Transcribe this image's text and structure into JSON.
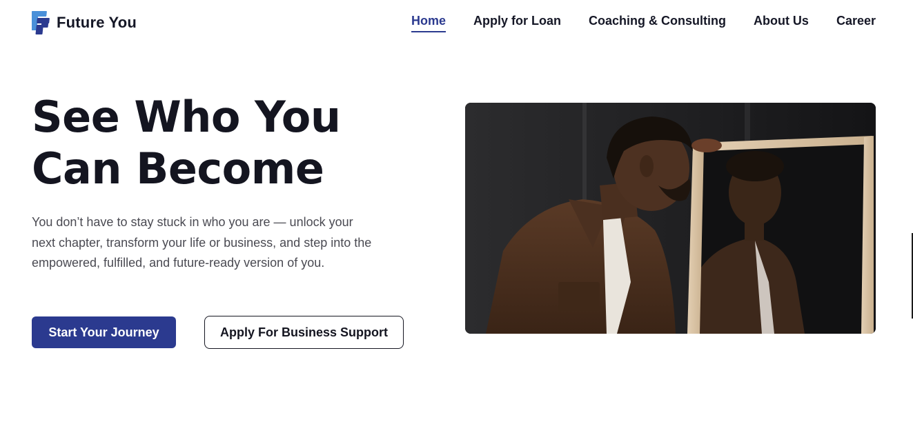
{
  "brand": {
    "name": "Future You",
    "logo_icon": "fy-logo-icon",
    "accent": "#2b3a8f"
  },
  "nav": {
    "items": [
      {
        "label": "Home",
        "active": true
      },
      {
        "label": "Apply for Loan",
        "active": false
      },
      {
        "label": "Coaching & Consulting",
        "active": false
      },
      {
        "label": "About Us",
        "active": false
      },
      {
        "label": "Career",
        "active": false
      }
    ]
  },
  "hero": {
    "title": "See Who You Can Become",
    "description": "You don’t have to stay stuck in who you are — unlock your next chapter, transform your life or business, and step into the empowered, fulfilled, and future-ready version of you.",
    "primary_button": "Start Your Journey",
    "secondary_button": "Apply For Business Support",
    "image_icon": "man-looking-in-mirror-photo"
  }
}
